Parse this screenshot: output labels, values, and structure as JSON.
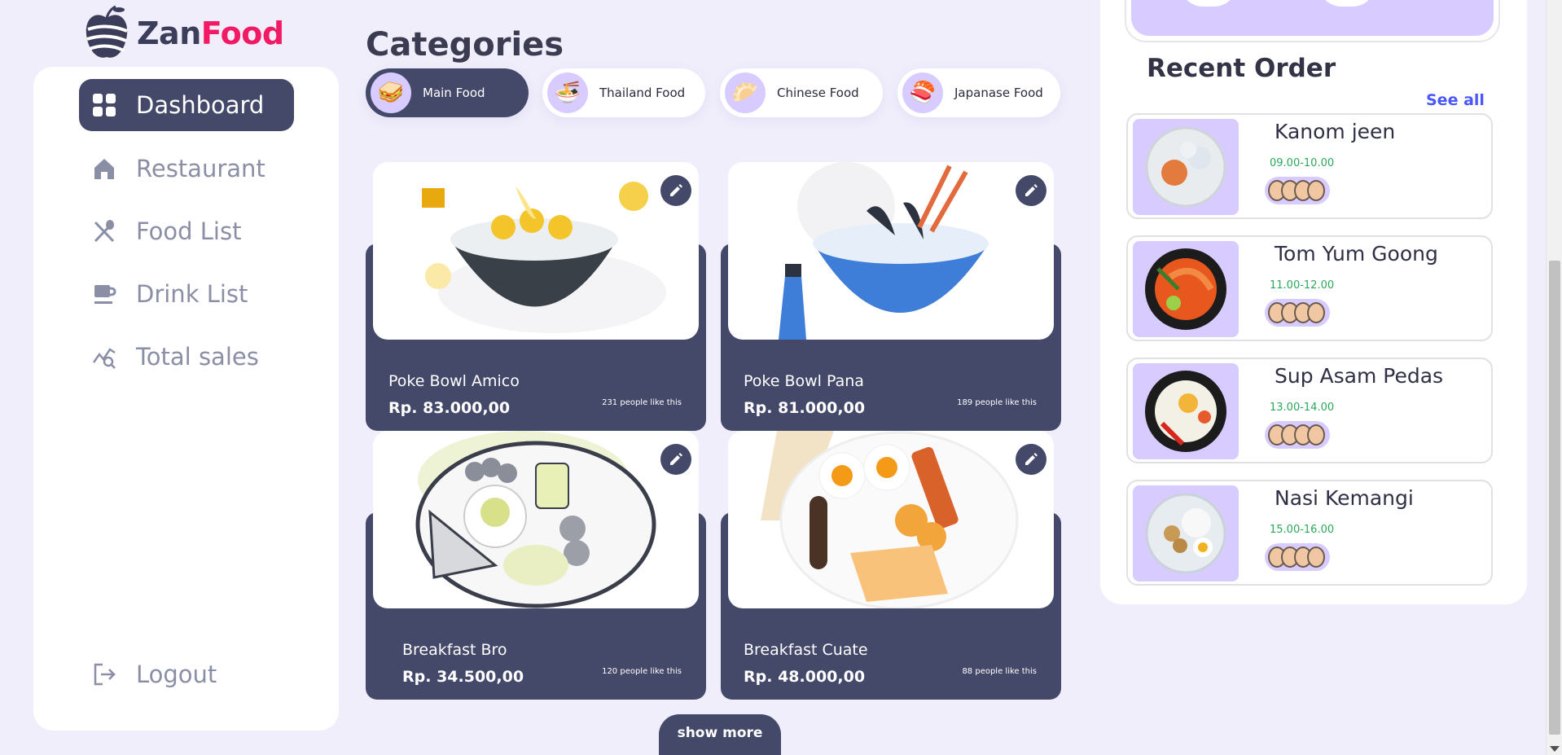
{
  "brand": {
    "part1": "Zan",
    "part2": "Food"
  },
  "sidebar": {
    "items": [
      {
        "label": "Dashboard",
        "icon": "dashboard-icon",
        "active": true
      },
      {
        "label": "Restaurant",
        "icon": "home-icon",
        "active": false
      },
      {
        "label": "Food List",
        "icon": "utensils-icon",
        "active": false
      },
      {
        "label": "Drink List",
        "icon": "cup-icon",
        "active": false
      },
      {
        "label": "Total sales",
        "icon": "sales-chart-icon",
        "active": false
      }
    ],
    "logout": {
      "label": "Logout",
      "icon": "logout-icon"
    }
  },
  "categories": {
    "title": "Categories",
    "items": [
      {
        "label": "Main Food",
        "icon": "sandwich-icon",
        "active": true
      },
      {
        "label": "Thailand Food",
        "icon": "noodle-bowl-icon",
        "active": false
      },
      {
        "label": "Chinese Food",
        "icon": "dumpling-icon",
        "active": false
      },
      {
        "label": "Japanase Food",
        "icon": "sushi-icon",
        "active": false
      }
    ]
  },
  "foods": [
    {
      "name": "Poke Bowl Amico",
      "price": "Rp. 83.000,00",
      "likes": "231 people like this"
    },
    {
      "name": "Poke Bowl Pana",
      "price": "Rp. 81.000,00",
      "likes": "189 people like this"
    },
    {
      "name": "Breakfast Bro",
      "price": "Rp. 34.500,00",
      "likes": "120 people like this"
    },
    {
      "name": "Breakfast Cuate",
      "price": "Rp. 48.000,00",
      "likes": "88 people like this"
    }
  ],
  "show_more": "show more",
  "recent_order": {
    "title": "Recent Order",
    "see_all": "See all",
    "orders": [
      {
        "name": "Kanom jeen",
        "time": "09.00-10.00"
      },
      {
        "name": "Tom Yum Goong",
        "time": "11.00-12.00"
      },
      {
        "name": "Sup Asam Pedas",
        "time": "13.00-14.00"
      },
      {
        "name": "Nasi Kemangi",
        "time": "15.00-16.00"
      }
    ]
  },
  "colors": {
    "accent": "#444869",
    "brand_pink": "#f21a64",
    "lavender": "#d8cbff",
    "link_blue": "#4a57ff",
    "time_green": "#2aa85a"
  }
}
